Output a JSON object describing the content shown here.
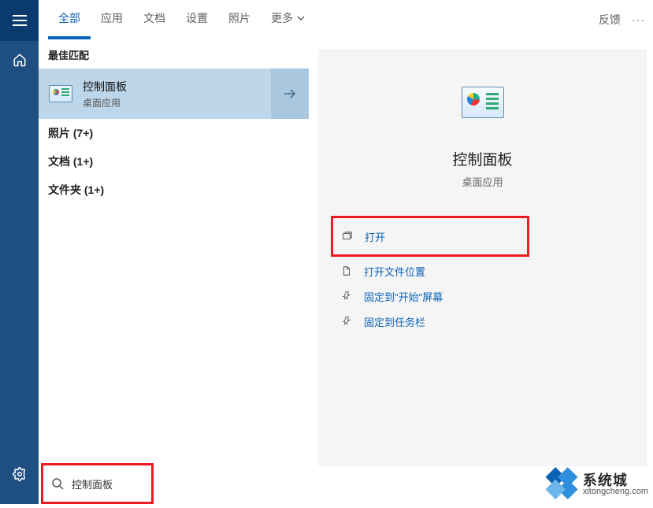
{
  "tabs": {
    "all": "全部",
    "apps": "应用",
    "docs": "文档",
    "settings": "设置",
    "photos": "照片",
    "more": "更多"
  },
  "top_right": {
    "feedback": "反馈",
    "dots": "···"
  },
  "left": {
    "best_match_header": "最佳匹配",
    "best_match": {
      "title": "控制面板",
      "subtitle": "桌面应用"
    },
    "categories": {
      "photos": "照片 (7+)",
      "docs": "文档 (1+)",
      "folders": "文件夹 (1+)"
    }
  },
  "right": {
    "title": "控制面板",
    "subtitle": "桌面应用",
    "actions": {
      "open": "打开",
      "open_file_location": "打开文件位置",
      "pin_start": "固定到\"开始\"屏幕",
      "pin_taskbar": "固定到任务栏"
    }
  },
  "search": {
    "value": "控制面板"
  },
  "watermark": {
    "cn": "系统城",
    "en": "xitongcheng.com"
  }
}
